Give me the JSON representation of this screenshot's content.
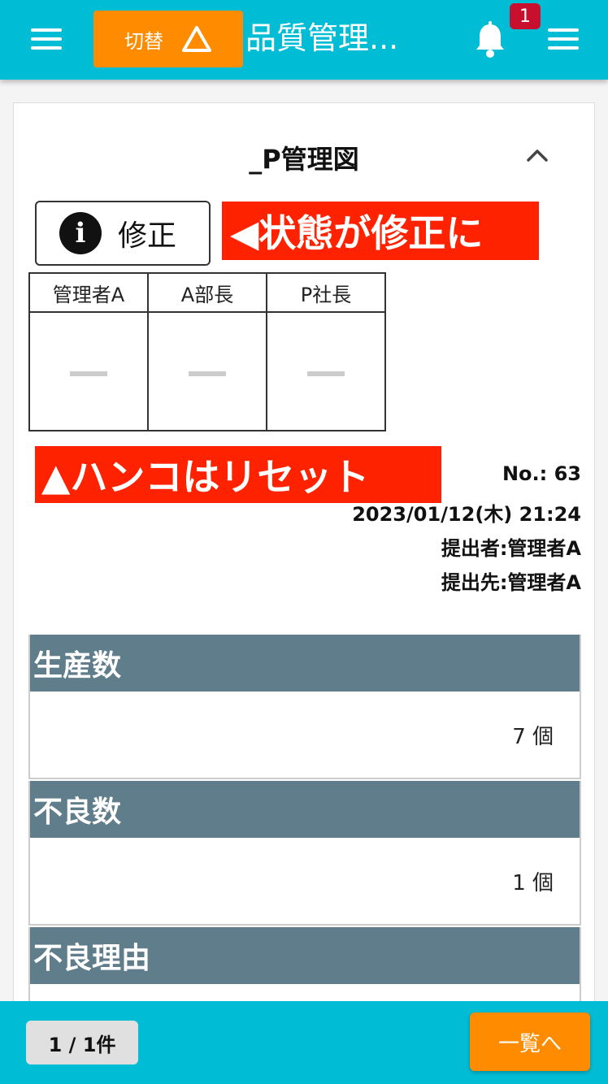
{
  "header": {
    "switch_label": "切替",
    "title": "品質管理...",
    "notification_count": "1"
  },
  "document": {
    "title": "_P管理図",
    "status_label": "修正",
    "annotation_status": "◀状態が修正に",
    "annotation_stamp": "▲ハンコはリセット",
    "approvers": [
      "管理者A",
      "A部長",
      "P社長"
    ],
    "stamp_placeholder": "―",
    "number": "No.: 63",
    "datetime": "2023/01/12(木) 21:24",
    "submitter": "提出者:管理者A",
    "recipient": "提出先:管理者A"
  },
  "sections": [
    {
      "label": "生産数",
      "value": "7 個"
    },
    {
      "label": "不良数",
      "value": "1 個"
    },
    {
      "label": "不良理由",
      "value": ""
    }
  ],
  "footer": {
    "page_count": "1 / 1件",
    "list_button": "一覧へ"
  },
  "colors": {
    "header_bg": "#00bcd4",
    "accent_orange": "#ff8c00",
    "section_header": "#607d8b",
    "annotation_red": "#ff2200",
    "badge_red": "#c8102e"
  }
}
